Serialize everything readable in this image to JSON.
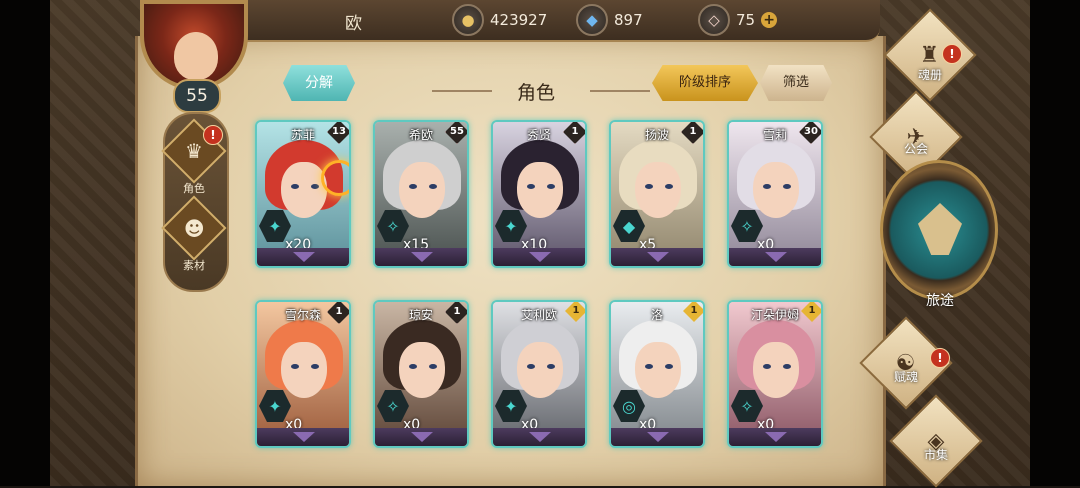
{
  "player": {
    "name": "欧",
    "level": "55"
  },
  "resources": {
    "gold": "423927",
    "crystal": "897",
    "gem": "75",
    "add_label": "+"
  },
  "left_nav": {
    "items": [
      {
        "label": "角色",
        "icon": "character-icon",
        "alert": "!"
      },
      {
        "label": "素材",
        "icon": "materials-icon"
      }
    ]
  },
  "header": {
    "decompose_label": "分解",
    "title": "角色",
    "sort_label": "阶级排序",
    "filter_label": "筛选"
  },
  "cards": [
    {
      "name": "苏菲",
      "badge": "13",
      "count": "x20",
      "hair": "#d23a2e",
      "badge_style": "dark",
      "icon": "✦"
    },
    {
      "name": "希欧",
      "badge": "55",
      "count": "x15",
      "hair": "#cfcfcf",
      "badge_style": "dark",
      "icon": "✧"
    },
    {
      "name": "秀贤",
      "badge": "1",
      "count": "x10",
      "hair": "#2a2230",
      "badge_style": "dark",
      "icon": "✦"
    },
    {
      "name": "扬波",
      "badge": "1",
      "count": "x5",
      "hair": "#e8dcc0",
      "badge_style": "dark",
      "icon": "◆"
    },
    {
      "name": "雪莉",
      "badge": "30",
      "count": "x0",
      "hair": "#e2dde6",
      "badge_style": "dark",
      "icon": "✧"
    },
    {
      "name": "雪尔森",
      "badge": "1",
      "count": "x0",
      "hair": "#ef7a4a",
      "badge_style": "dark",
      "icon": "✦"
    },
    {
      "name": "琼安",
      "badge": "1",
      "count": "x0",
      "hair": "#3a2a22",
      "badge_style": "dark",
      "icon": "✧"
    },
    {
      "name": "艾利欧",
      "badge": "1",
      "count": "x0",
      "hair": "#cfcfd4",
      "badge_style": "gold",
      "icon": "✦"
    },
    {
      "name": "洛",
      "badge": "1",
      "count": "x0",
      "hair": "#eeeeee",
      "badge_style": "gold",
      "icon": "◎"
    },
    {
      "name": "汀朵伊姆",
      "badge": "1",
      "count": "x0",
      "hair": "#d98fa0",
      "badge_style": "gold",
      "icon": "✧"
    }
  ],
  "right_nav": {
    "soul_book": {
      "label": "魂册",
      "alert": "!"
    },
    "guild": {
      "label": "公会"
    },
    "journey": {
      "label": "旅途"
    },
    "soul_gift": {
      "label": "赋魂",
      "alert": "!"
    },
    "market": {
      "label": "市集"
    }
  },
  "colors": {
    "accent_teal": "#5fc9c0",
    "accent_gold": "#e6b534",
    "alert_red": "#c4321f"
  }
}
